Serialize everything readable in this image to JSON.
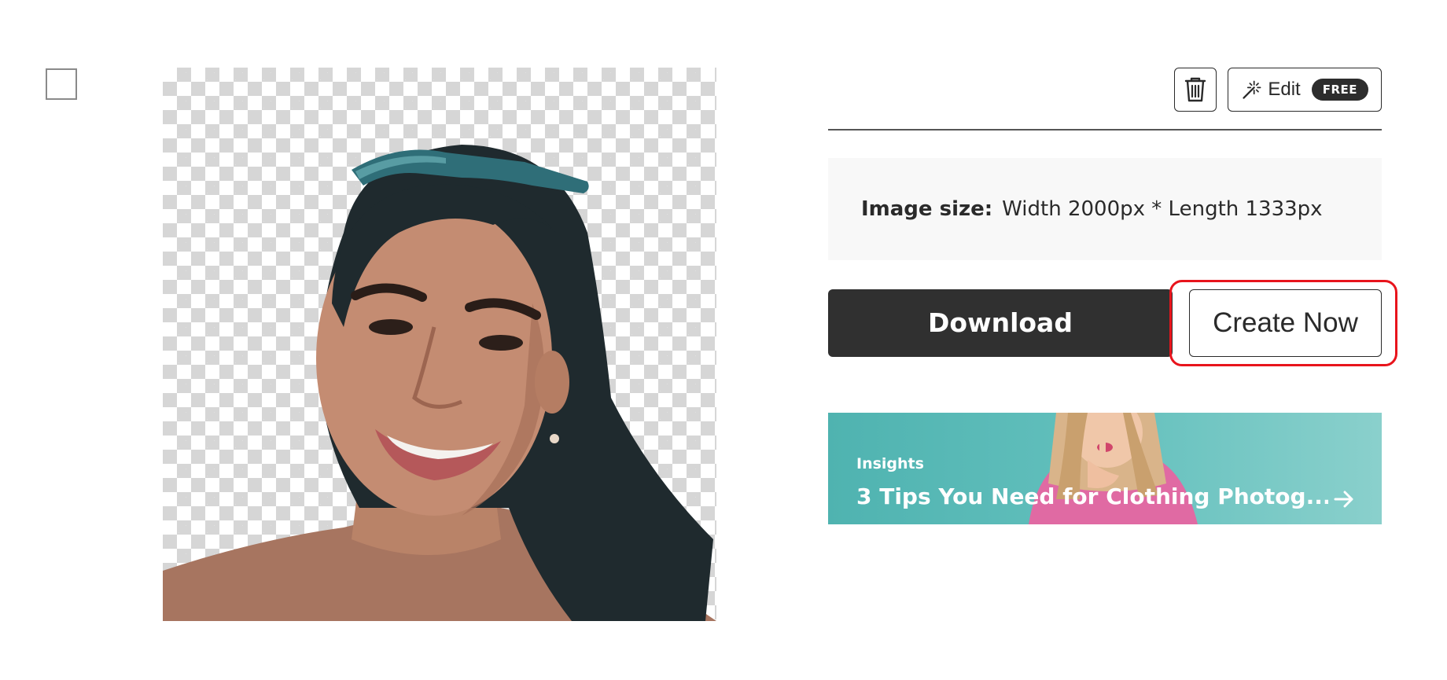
{
  "selection": {
    "checkbox_checked": false
  },
  "preview": {
    "alt": "Woman with sunglasses on head, background removed"
  },
  "toolbar": {
    "delete_icon": "trash-icon",
    "edit_icon": "magic-wand-icon",
    "edit_label": "Edit",
    "free_badge": "FREE"
  },
  "info": {
    "size_label": "Image size:",
    "size_value": "Width 2000px * Length 1333px"
  },
  "actions": {
    "download_label": "Download",
    "create_label": "Create Now",
    "highlight_color": "#e8141c"
  },
  "banner": {
    "kicker": "Insights",
    "title": "3 Tips You Need for Clothing Photog...",
    "arrow_icon": "arrow-right-icon",
    "background_color": "#63c0bd"
  }
}
